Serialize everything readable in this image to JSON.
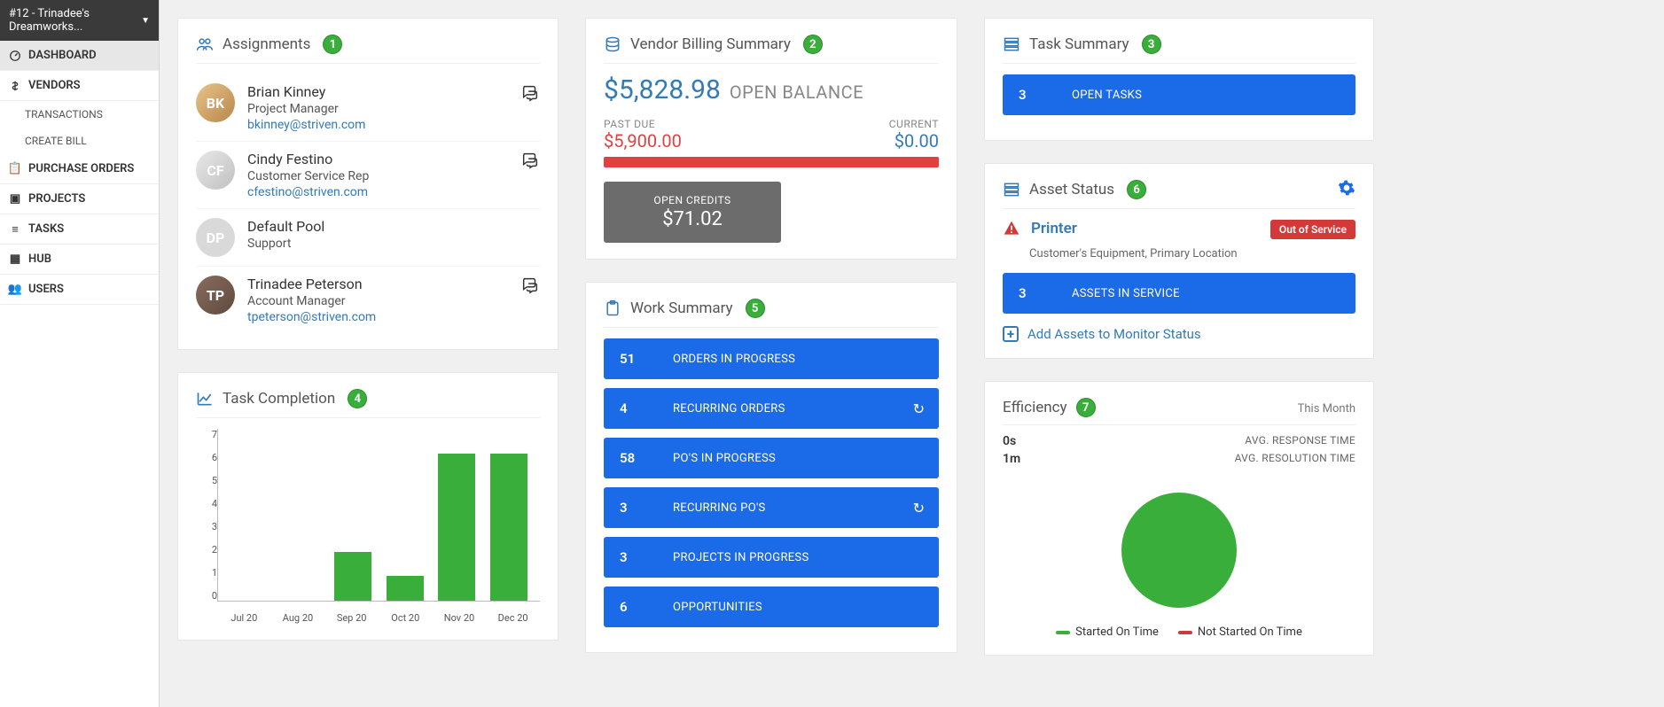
{
  "sidebar": {
    "workspace": "#12 - Trinadee's Dreamworks...",
    "items": [
      {
        "label": "DASHBOARD",
        "active": true
      },
      {
        "label": "VENDORS",
        "children": [
          "TRANSACTIONS",
          "CREATE BILL"
        ]
      },
      {
        "label": "PURCHASE ORDERS"
      },
      {
        "label": "PROJECTS"
      },
      {
        "label": "TASKS"
      },
      {
        "label": "HUB"
      },
      {
        "label": "USERS"
      }
    ]
  },
  "assignments": {
    "title": "Assignments",
    "marker": "1",
    "people": [
      {
        "name": "Brian Kinney",
        "role": "Project Manager",
        "email": "bkinney@striven.com",
        "initials": "BK",
        "chat": true,
        "avatarClass": "bk"
      },
      {
        "name": "Cindy Festino",
        "role": "Customer Service Rep",
        "email": "cfestino@striven.com",
        "initials": "CF",
        "chat": true,
        "avatarClass": "cf"
      },
      {
        "name": "Default Pool",
        "role": "Support",
        "email": "",
        "initials": "DP",
        "chat": false,
        "avatarClass": "dp"
      },
      {
        "name": "Trinadee Peterson",
        "role": "Account Manager",
        "email": "tpeterson@striven.com",
        "initials": "TP",
        "chat": true,
        "avatarClass": "tp"
      }
    ]
  },
  "taskCompletion": {
    "title": "Task Completion",
    "marker": "4"
  },
  "billing": {
    "title": "Vendor Billing Summary",
    "marker": "2",
    "openBalance": "$5,828.98",
    "openBalanceLabel": "OPEN BALANCE",
    "pastDueLabel": "PAST DUE",
    "pastDue": "$5,900.00",
    "currentLabel": "CURRENT",
    "current": "$0.00",
    "creditsLabel": "OPEN CREDITS",
    "credits": "$71.02"
  },
  "workSummary": {
    "title": "Work Summary",
    "marker": "5",
    "items": [
      {
        "num": "51",
        "label": "ORDERS IN PROGRESS",
        "refresh": false
      },
      {
        "num": "4",
        "label": "RECURRING ORDERS",
        "refresh": true
      },
      {
        "num": "58",
        "label": "PO'S IN PROGRESS",
        "refresh": false
      },
      {
        "num": "3",
        "label": "RECURRING PO'S",
        "refresh": true
      },
      {
        "num": "3",
        "label": "PROJECTS IN PROGRESS",
        "refresh": false
      },
      {
        "num": "6",
        "label": "OPPORTUNITIES",
        "refresh": false
      }
    ]
  },
  "taskSummary": {
    "title": "Task Summary",
    "marker": "3",
    "num": "3",
    "label": "OPEN TASKS"
  },
  "assetStatus": {
    "title": "Asset Status",
    "marker": "6",
    "assetName": "Printer",
    "badge": "Out of Service",
    "sub": "Customer's Equipment, Primary Location",
    "serviceNum": "3",
    "serviceLabel": "ASSETS IN SERVICE",
    "addLabel": "Add Assets to Monitor Status"
  },
  "efficiency": {
    "title": "Efficiency",
    "marker": "7",
    "period": "This Month",
    "responseVal": "0s",
    "responseLabel": "AVG. RESPONSE TIME",
    "resolutionVal": "1m",
    "resolutionLabel": "AVG. RESOLUTION TIME",
    "legend": [
      {
        "color": "#3aae3a",
        "label": "Started On Time"
      },
      {
        "color": "#d43939",
        "label": "Not Started On Time"
      }
    ]
  },
  "chart_data": {
    "type": "bar",
    "title": "Task Completion",
    "categories": [
      "Jul 20",
      "Aug 20",
      "Sep 20",
      "Oct 20",
      "Nov 20",
      "Dec 20"
    ],
    "values": [
      0,
      0,
      2,
      1,
      6,
      6
    ],
    "ylim": [
      0,
      7
    ],
    "yticks": [
      0,
      1,
      2,
      3,
      4,
      5,
      6,
      7
    ],
    "xlabel": "",
    "ylabel": ""
  }
}
